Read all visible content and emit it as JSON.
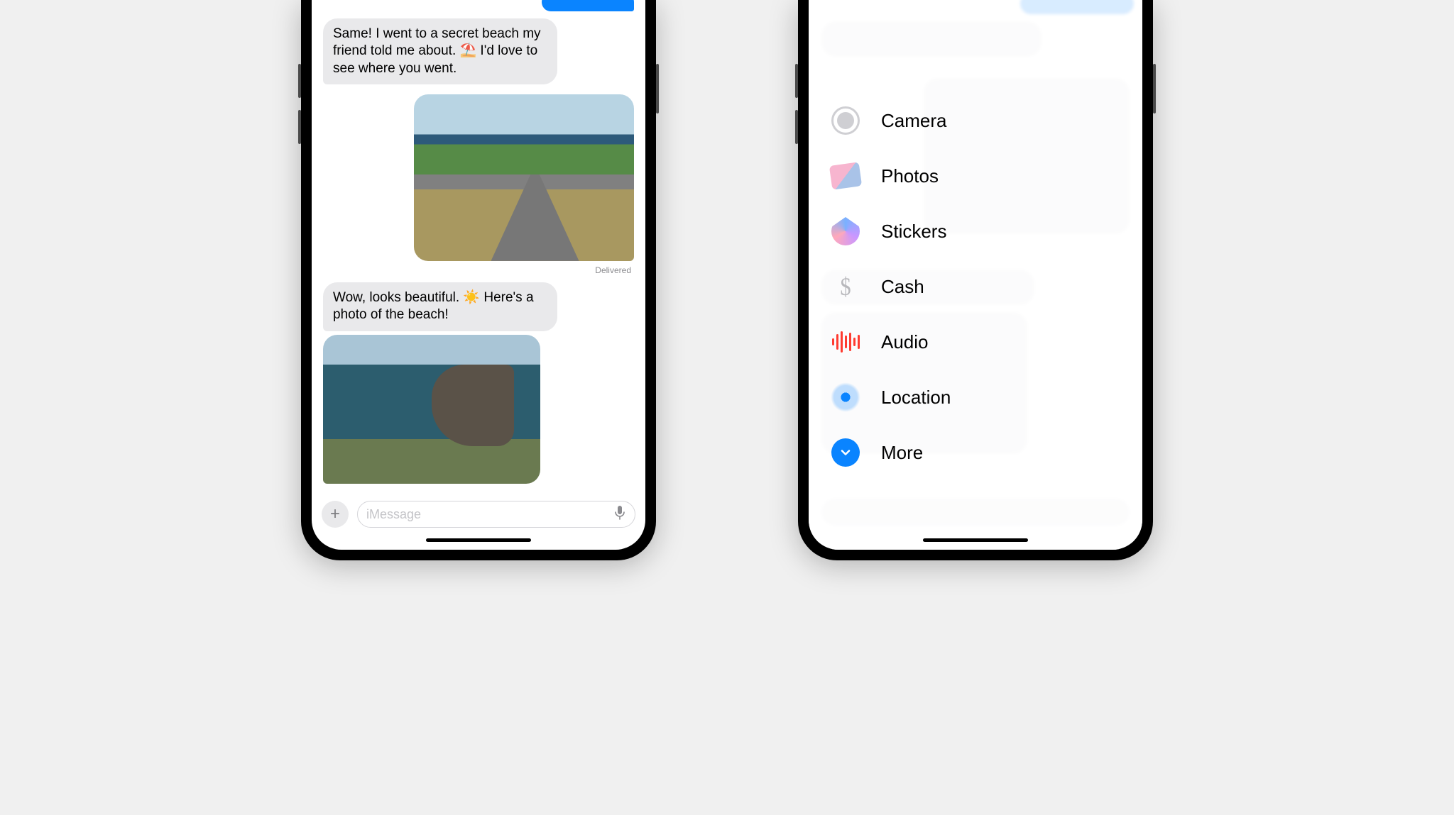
{
  "conversation": {
    "messages": [
      {
        "role": "received",
        "text": "Same! I went to a secret beach my friend told me about. ⛱️ I'd love to see where you went."
      },
      {
        "role": "sent-photo",
        "alt": "coastal road through grassy hills"
      },
      {
        "role": "status",
        "text": "Delivered"
      },
      {
        "role": "received",
        "text": "Wow, looks beautiful. ☀️ Here's a photo of the beach!"
      },
      {
        "role": "received-photo",
        "alt": "rocky sea cliff with waves"
      }
    ],
    "composer": {
      "placeholder": "iMessage"
    }
  },
  "app_drawer": {
    "items": [
      {
        "icon": "camera-icon",
        "label": "Camera"
      },
      {
        "icon": "photos-icon",
        "label": "Photos"
      },
      {
        "icon": "stickers-icon",
        "label": "Stickers"
      },
      {
        "icon": "cash-icon",
        "label": "Cash"
      },
      {
        "icon": "audio-icon",
        "label": "Audio"
      },
      {
        "icon": "location-icon",
        "label": "Location"
      },
      {
        "icon": "more-icon",
        "label": "More"
      }
    ]
  }
}
